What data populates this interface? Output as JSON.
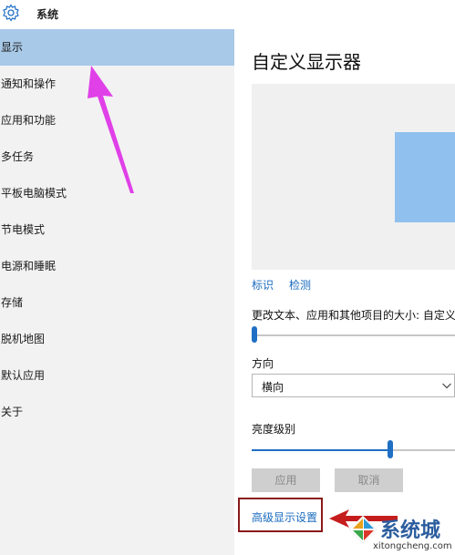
{
  "window": {
    "title": "系统"
  },
  "sidebar": {
    "items": [
      {
        "label": "显示",
        "selected": true
      },
      {
        "label": "通知和操作"
      },
      {
        "label": "应用和功能"
      },
      {
        "label": "多任务"
      },
      {
        "label": "平板电脑模式"
      },
      {
        "label": "节电模式"
      },
      {
        "label": "电源和睡眠"
      },
      {
        "label": "存储"
      },
      {
        "label": "脱机地图"
      },
      {
        "label": "默认应用"
      },
      {
        "label": "关于"
      }
    ]
  },
  "main": {
    "title": "自定义显示器",
    "identify_link": "标识",
    "detect_link": "检测",
    "scale_label": "更改文本、应用和其他项目的大小: 自定义",
    "orientation_label": "方向",
    "orientation_value": "横向",
    "brightness_label": "亮度级别",
    "brightness_level": 0.68,
    "apply_button": "应用",
    "cancel_button": "取消",
    "advanced_link": "高级显示设置"
  },
  "watermark": {
    "text": "系统城",
    "url": "xitongcheng.com"
  },
  "colors": {
    "accent": "#1f6fc4",
    "selected_bg": "#a8c9e8",
    "sidebar_bg": "#f2f2f2",
    "link": "#1a6bbf",
    "annotation_arrow_magenta": "#e040e8",
    "annotation_box_red": "#8b1a1a"
  },
  "icons": {
    "title": "gear-icon",
    "dropdown": "chevron-down-icon"
  }
}
